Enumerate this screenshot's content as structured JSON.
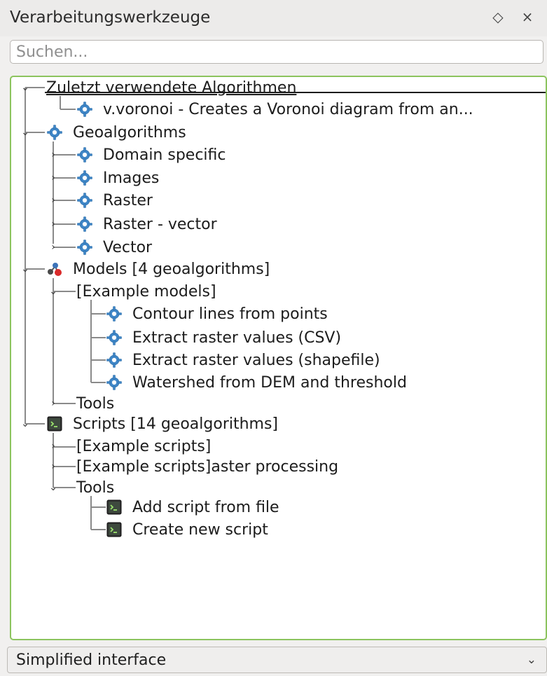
{
  "panel": {
    "title": "Verarbeitungswerkzeuge",
    "float_icon": "diamond-icon",
    "close_icon": "close-icon"
  },
  "search": {
    "placeholder": "Suchen...",
    "value": ""
  },
  "tree": {
    "recent": {
      "label": "Zuletzt verwendete Algorithmen",
      "items": [
        "v.voronoi - Creates a Voronoi diagram from an..."
      ]
    },
    "geoalgorithms": {
      "label": "Geoalgorithms",
      "children": [
        "Domain specific",
        "Images",
        "Raster",
        "Raster - vector",
        "Vector"
      ]
    },
    "models": {
      "label": "Models [4 geoalgorithms]",
      "example_group": "[Example models]",
      "example_items": [
        "Contour lines from points",
        "Extract raster values (CSV)",
        "Extract raster values (shapefile)",
        "Watershed from DEM and threshold"
      ],
      "tools": "Tools"
    },
    "scripts": {
      "label": "Scripts [14 geoalgorithms]",
      "groups": [
        "[Example scripts]",
        "[Example scripts]aster processing"
      ],
      "tools": "Tools",
      "tools_items": [
        "Add script from file",
        "Create new script"
      ]
    },
    "icons": {
      "gear": "gear-icon",
      "model": "model-icon",
      "script": "script-icon"
    },
    "colors": {
      "gear": "#3f86c7",
      "focus_border": "#8cc45e"
    }
  },
  "footer": {
    "mode_label": "Simplified interface"
  }
}
